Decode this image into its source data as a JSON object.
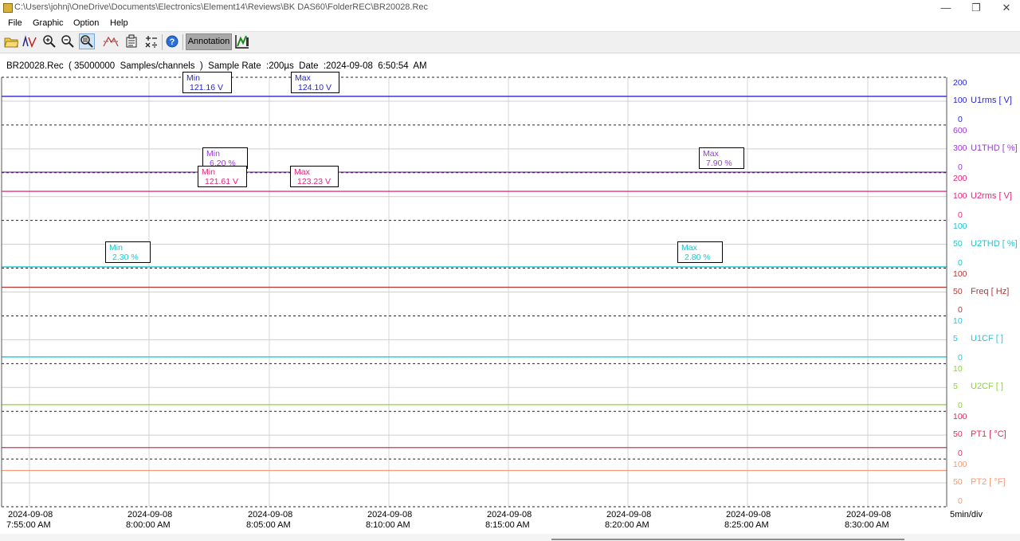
{
  "window": {
    "title": "C:\\Users\\johnj\\OneDrive\\Documents\\Electronics\\Element14\\Reviews\\BK DAS60\\FolderREC\\BR20028.Rec",
    "minimize": "—",
    "restore": "❐",
    "close": "✕"
  },
  "menu": [
    "File",
    "Graphic",
    "Option",
    "Help"
  ],
  "toolbar": {
    "annotation_label": "Annotation",
    "icons": [
      "open-folder-icon",
      "channel-wave-icon",
      "zoom-in-icon",
      "zoom-out-icon",
      "zoom-fit-icon",
      "trace-icon",
      "properties-icon",
      "scale-icon",
      "help-icon",
      "annotation-toggle-icon",
      "chart-tool-icon"
    ]
  },
  "info_line": "BR20028.Rec  ( 35000000  Samples/channels  )  Sample Rate  :200µs  Date  :2024-09-08  6:50:54  AM",
  "channels": [
    {
      "label": "U1rms [ V]",
      "color": "#2626d0",
      "ticks": [
        "200",
        "100",
        "0"
      ],
      "level": 0.6
    },
    {
      "label": "U1THD [ %]",
      "color": "#9a3ad8",
      "ticks": [
        "600",
        "300",
        "0"
      ],
      "level": 0.012
    },
    {
      "label": "U2rms [ V]",
      "color": "#e0287a",
      "ticks": [
        "200",
        "100",
        "0"
      ],
      "level": 0.61
    },
    {
      "label": "U2THD [ %]",
      "color": "#22c4cc",
      "ticks": [
        "100",
        "50",
        "0"
      ],
      "level": 0.027
    },
    {
      "label": "Freq [ Hz]",
      "color": "#b03838",
      "ticks": [
        "100",
        "50",
        "0"
      ],
      "level": 0.6
    },
    {
      "label": "U1CF [ ]",
      "color": "#20c8e0",
      "ticks": [
        "10",
        "5",
        "0"
      ],
      "level": 0.14
    },
    {
      "label": "U2CF [ ]",
      "color": "#88d828",
      "ticks": [
        "10",
        "5",
        "0"
      ],
      "level": 0.14
    },
    {
      "label": "PT1 [ °C]",
      "color": "#d8305a",
      "ticks": [
        "100",
        "50",
        "0"
      ],
      "level": 0.24
    },
    {
      "label": "PT2 [ °F]",
      "color": "#f29a7a",
      "ticks": [
        "100",
        "50",
        "0"
      ],
      "level": 0.76
    }
  ],
  "annotations": [
    {
      "kind": "Min",
      "value": "121.16  V",
      "color": "#2626d0",
      "channel": 0
    },
    {
      "kind": "Max",
      "value": "124.10  V",
      "color": "#2626d0",
      "channel": 0
    },
    {
      "kind": "Min",
      "value": "6.20  %",
      "color": "#9a3ad8",
      "channel": 1
    },
    {
      "kind": "Max",
      "value": "7.90  %",
      "color": "#9a3ad8",
      "channel": 1
    },
    {
      "kind": "Min",
      "value": "121.61  V",
      "color": "#e0287a",
      "channel": 2
    },
    {
      "kind": "Max",
      "value": "123.23  V",
      "color": "#e0287a",
      "channel": 2
    },
    {
      "kind": "Min",
      "value": "2.30  %",
      "color": "#22c4cc",
      "channel": 3
    },
    {
      "kind": "Max",
      "value": "2.80  %",
      "color": "#22c4cc",
      "channel": 3
    }
  ],
  "time_axis": {
    "labels": [
      {
        "date": "2024-09-08",
        "time": "7:55:00 AM"
      },
      {
        "date": "2024-09-08",
        "time": "8:00:00 AM"
      },
      {
        "date": "2024-09-08",
        "time": "8:05:00 AM"
      },
      {
        "date": "2024-09-08",
        "time": "8:10:00 AM"
      },
      {
        "date": "2024-09-08",
        "time": "8:15:00 AM"
      },
      {
        "date": "2024-09-08",
        "time": "8:20:00 AM"
      },
      {
        "date": "2024-09-08",
        "time": "8:25:00 AM"
      },
      {
        "date": "2024-09-08",
        "time": "8:30:00 AM"
      }
    ],
    "per_div": "5min/div"
  }
}
